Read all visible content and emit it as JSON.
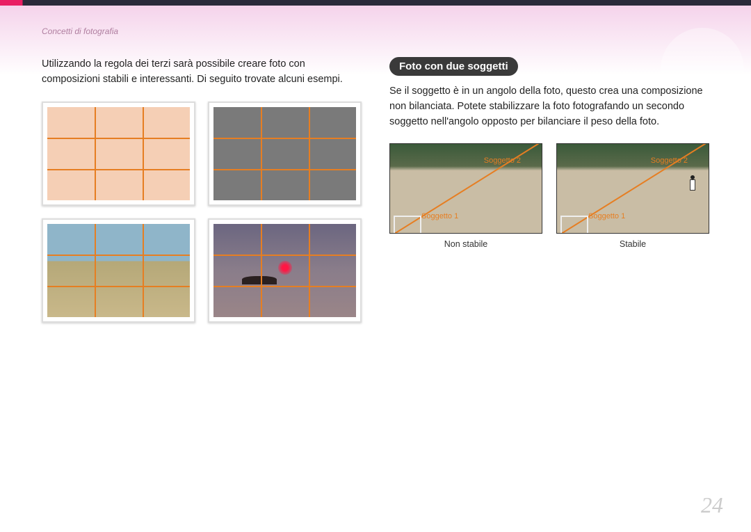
{
  "breadcrumb": "Concetti di fotografia",
  "left": {
    "intro": "Utilizzando la regola dei terzi sarà possibile creare foto con composizioni stabili e interessanti. Di seguito trovate alcuni esempi."
  },
  "right": {
    "heading": "Foto con due soggetti",
    "body": "Se il soggetto è in un angolo della foto, questo crea una composizione non bilanciata. Potete stabilizzare la foto fotografando un secondo soggetto nell'angolo opposto per bilanciare il peso della foto.",
    "labels": {
      "subject1": "Soggetto 1",
      "subject2": "Soggetto 2"
    },
    "captions": {
      "unstable": "Non stabile",
      "stable": "Stabile"
    }
  },
  "page_number": "24"
}
